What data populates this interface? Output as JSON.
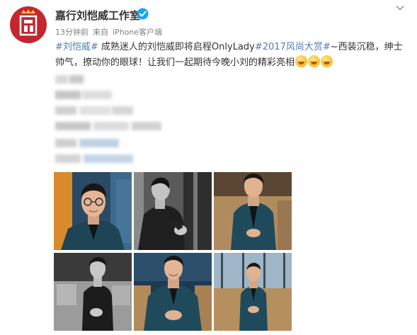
{
  "post": {
    "author": "嘉行刘恺威工作室",
    "time": "13分钟前",
    "source_prefix": "来自",
    "source": "iPhone客户端",
    "text": {
      "tag1": "#刘恺威#",
      "part1": " 成熟迷人的刘恺威即将启程OnlyLady",
      "tag2": "#2017风尚大赏#",
      "part2": "~西装沉稳，绅士帅气，撩动你的眼球！让我们一起期待今晚小刘的精彩亮相"
    },
    "emoji_count": 3,
    "photos": [
      {
        "scene": "man-glasses-teal-suit"
      },
      {
        "scene": "bw-man-adjusting-cuff"
      },
      {
        "scene": "man-teal-suit-seated"
      },
      {
        "scene": "bw-man-seated-sofa"
      },
      {
        "scene": "man-teal-suit-smiling"
      },
      {
        "scene": "man-teal-suit-window-seated"
      }
    ]
  },
  "colors": {
    "accent": "#c3262f",
    "link": "#507daf",
    "meta": "#808080",
    "verified": "#1ea1f2",
    "suit_teal": "#1f4a5c"
  },
  "icons": [
    "verified-icon",
    "chevron-down-icon",
    "avatar-logo-icon",
    "laugh-cry-emoji-icon"
  ]
}
